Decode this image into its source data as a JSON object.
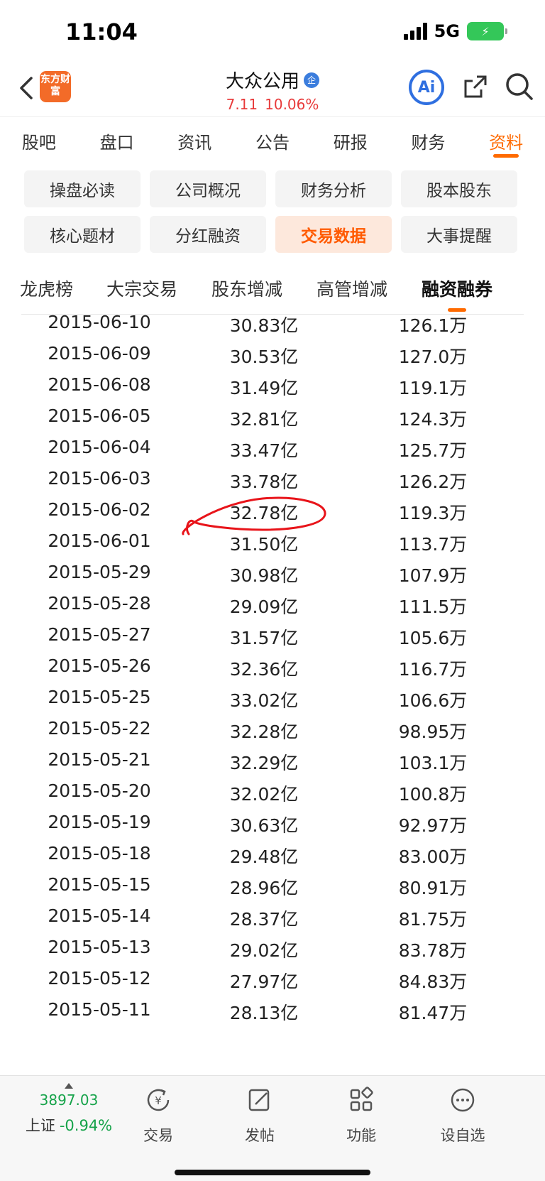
{
  "status": {
    "time": "11:04",
    "network": "5G"
  },
  "header": {
    "logo_text": "东方财富",
    "stock_name": "大众公用",
    "ent_badge": "企",
    "price": "7.11",
    "change_pct": "10.06%",
    "ai_label": "Ai"
  },
  "main_tabs": [
    {
      "label": "股吧"
    },
    {
      "label": "盘口"
    },
    {
      "label": "资讯"
    },
    {
      "label": "公告"
    },
    {
      "label": "研报"
    },
    {
      "label": "财务"
    },
    {
      "label": "资料"
    }
  ],
  "section_buttons": [
    {
      "label": "操盘必读"
    },
    {
      "label": "公司概况"
    },
    {
      "label": "财务分析"
    },
    {
      "label": "股本股东"
    },
    {
      "label": "核心题材"
    },
    {
      "label": "分红融资"
    },
    {
      "label": "交易数据"
    },
    {
      "label": "大事提醒"
    }
  ],
  "sub_tabs": [
    {
      "label": "龙虎榜"
    },
    {
      "label": "大宗交易"
    },
    {
      "label": "股东增减"
    },
    {
      "label": "高管增减"
    },
    {
      "label": "融资融券"
    }
  ],
  "table": {
    "rows": [
      {
        "date": "2015-06-10",
        "balance": "30.83亿",
        "volume": "126.1万"
      },
      {
        "date": "2015-06-09",
        "balance": "30.53亿",
        "volume": "127.0万"
      },
      {
        "date": "2015-06-08",
        "balance": "31.49亿",
        "volume": "119.1万"
      },
      {
        "date": "2015-06-05",
        "balance": "32.81亿",
        "volume": "124.3万"
      },
      {
        "date": "2015-06-04",
        "balance": "33.47亿",
        "volume": "125.7万"
      },
      {
        "date": "2015-06-03",
        "balance": "33.78亿",
        "volume": "126.2万"
      },
      {
        "date": "2015-06-02",
        "balance": "32.78亿",
        "volume": "119.3万"
      },
      {
        "date": "2015-06-01",
        "balance": "31.50亿",
        "volume": "113.7万"
      },
      {
        "date": "2015-05-29",
        "balance": "30.98亿",
        "volume": "107.9万"
      },
      {
        "date": "2015-05-28",
        "balance": "29.09亿",
        "volume": "111.5万"
      },
      {
        "date": "2015-05-27",
        "balance": "31.57亿",
        "volume": "105.6万"
      },
      {
        "date": "2015-05-26",
        "balance": "32.36亿",
        "volume": "116.7万"
      },
      {
        "date": "2015-05-25",
        "balance": "33.02亿",
        "volume": "106.6万"
      },
      {
        "date": "2015-05-22",
        "balance": "32.28亿",
        "volume": "98.95万"
      },
      {
        "date": "2015-05-21",
        "balance": "32.29亿",
        "volume": "103.1万"
      },
      {
        "date": "2015-05-20",
        "balance": "32.02亿",
        "volume": "100.8万"
      },
      {
        "date": "2015-05-19",
        "balance": "30.63亿",
        "volume": "92.97万"
      },
      {
        "date": "2015-05-18",
        "balance": "29.48亿",
        "volume": "83.00万"
      },
      {
        "date": "2015-05-15",
        "balance": "28.96亿",
        "volume": "80.91万"
      },
      {
        "date": "2015-05-14",
        "balance": "28.37亿",
        "volume": "81.75万"
      },
      {
        "date": "2015-05-13",
        "balance": "29.02亿",
        "volume": "83.78万"
      },
      {
        "date": "2015-05-12",
        "balance": "27.97亿",
        "volume": "84.83万"
      },
      {
        "date": "2015-05-11",
        "balance": "28.13亿",
        "volume": "81.47万"
      }
    ]
  },
  "bottom_bar": {
    "index_value": "3897.03",
    "index_name": "上证",
    "index_change": "-0.94%",
    "nav": [
      {
        "label": "交易",
        "icon": "trade-icon"
      },
      {
        "label": "发帖",
        "icon": "post-icon"
      },
      {
        "label": "功能",
        "icon": "function-icon"
      },
      {
        "label": "设自选",
        "icon": "add-watchlist-icon"
      }
    ]
  },
  "colors": {
    "accent": "#ff6a00",
    "up": "#e83a3a",
    "down": "#16a34a",
    "annotation": "#e8141a"
  }
}
